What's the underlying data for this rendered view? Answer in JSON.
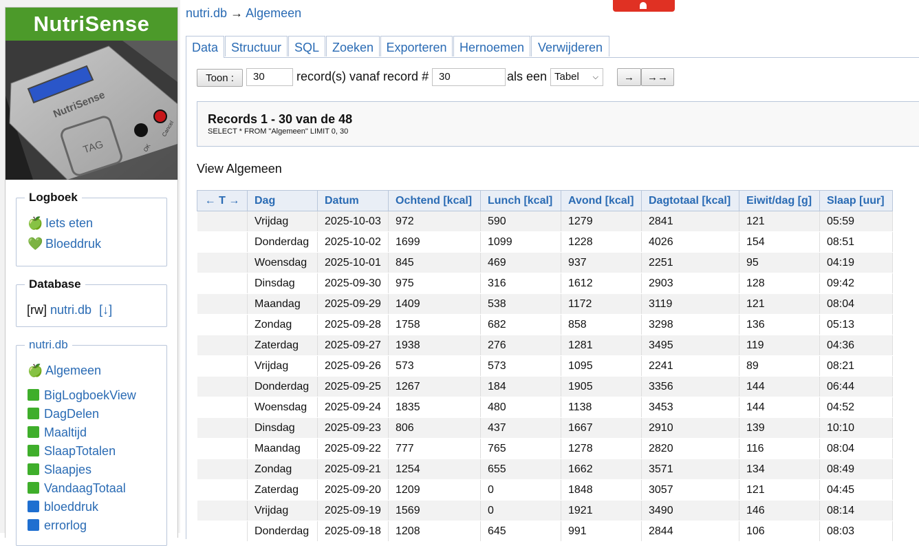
{
  "sidebar": {
    "brand": "NutriSense",
    "device_image": {
      "label": "NutriSense",
      "tag": "TAG",
      "ok": "OK",
      "cancel": "Cancel"
    },
    "logbook": {
      "title": "Logboek",
      "items": [
        {
          "icon": "apple-icon",
          "label": "Iets eten"
        },
        {
          "icon": "heart-icon",
          "label": "Bloeddruk"
        }
      ]
    },
    "database": {
      "title": "Database",
      "mode": "[rw]",
      "name": "nutri.db",
      "download": "[↓]"
    },
    "tables": {
      "title": "nutri.db",
      "active": {
        "icon": "apple-icon",
        "label": "Algemeen"
      },
      "items": [
        {
          "label": "BigLogboekView",
          "color": "#3fae2b"
        },
        {
          "label": "DagDelen",
          "color": "#3fae2b"
        },
        {
          "label": "Maaltijd",
          "color": "#3fae2b"
        },
        {
          "label": "SlaapTotalen",
          "color": "#3fae2b"
        },
        {
          "label": "Slaapjes",
          "color": "#3fae2b"
        },
        {
          "label": "VandaagTotaal",
          "color": "#3fae2b"
        },
        {
          "label": "bloeddruk",
          "color": "#1f6fd0"
        },
        {
          "label": "errorlog",
          "color": "#1f6fd0"
        }
      ]
    }
  },
  "breadcrumb": {
    "db": "nutri.db",
    "arrow": "→",
    "table": "Algemeen"
  },
  "tabs": [
    "Data",
    "Structuur",
    "SQL",
    "Zoeken",
    "Exporteren",
    "Hernoemen",
    "Verwijderen"
  ],
  "controls": {
    "show_button": "Toon :",
    "count_value": "30",
    "from_label": "record(s) vanaf record #",
    "start_value": "30",
    "as_label": "als een",
    "format_value": "Tabel",
    "next_button": "→",
    "last_button": "→→"
  },
  "records": {
    "title": "Records 1 - 30 van de 48",
    "sql": "SELECT * FROM \"Algemeen\" LIMIT 0, 30"
  },
  "view_title": "View Algemeen",
  "table": {
    "sort_header": "← T →",
    "columns": [
      "Dag",
      "Datum",
      "Ochtend [kcal]",
      "Lunch [kcal]",
      "Avond [kcal]",
      "Dagtotaal [kcal]",
      "Eiwit/dag [g]",
      "Slaap [uur]"
    ],
    "rows": [
      [
        "Vrijdag",
        "2025-10-03",
        "972",
        "590",
        "1279",
        "2841",
        "121",
        "05:59"
      ],
      [
        "Donderdag",
        "2025-10-02",
        "1699",
        "1099",
        "1228",
        "4026",
        "154",
        "08:51"
      ],
      [
        "Woensdag",
        "2025-10-01",
        "845",
        "469",
        "937",
        "2251",
        "95",
        "04:19"
      ],
      [
        "Dinsdag",
        "2025-09-30",
        "975",
        "316",
        "1612",
        "2903",
        "128",
        "09:42"
      ],
      [
        "Maandag",
        "2025-09-29",
        "1409",
        "538",
        "1172",
        "3119",
        "121",
        "08:04"
      ],
      [
        "Zondag",
        "2025-09-28",
        "1758",
        "682",
        "858",
        "3298",
        "136",
        "05:13"
      ],
      [
        "Zaterdag",
        "2025-09-27",
        "1938",
        "276",
        "1281",
        "3495",
        "119",
        "04:36"
      ],
      [
        "Vrijdag",
        "2025-09-26",
        "573",
        "573",
        "1095",
        "2241",
        "89",
        "08:21"
      ],
      [
        "Donderdag",
        "2025-09-25",
        "1267",
        "184",
        "1905",
        "3356",
        "144",
        "06:44"
      ],
      [
        "Woensdag",
        "2025-09-24",
        "1835",
        "480",
        "1138",
        "3453",
        "144",
        "04:52"
      ],
      [
        "Dinsdag",
        "2025-09-23",
        "806",
        "437",
        "1667",
        "2910",
        "139",
        "10:10"
      ],
      [
        "Maandag",
        "2025-09-22",
        "777",
        "765",
        "1278",
        "2820",
        "116",
        "08:04"
      ],
      [
        "Zondag",
        "2025-09-21",
        "1254",
        "655",
        "1662",
        "3571",
        "134",
        "08:49"
      ],
      [
        "Zaterdag",
        "2025-09-20",
        "1209",
        "0",
        "1848",
        "3057",
        "121",
        "04:45"
      ],
      [
        "Vrijdag",
        "2025-09-19",
        "1569",
        "0",
        "1921",
        "3490",
        "146",
        "08:14"
      ],
      [
        "Donderdag",
        "2025-09-18",
        "1208",
        "645",
        "991",
        "2844",
        "106",
        "08:03"
      ]
    ]
  }
}
